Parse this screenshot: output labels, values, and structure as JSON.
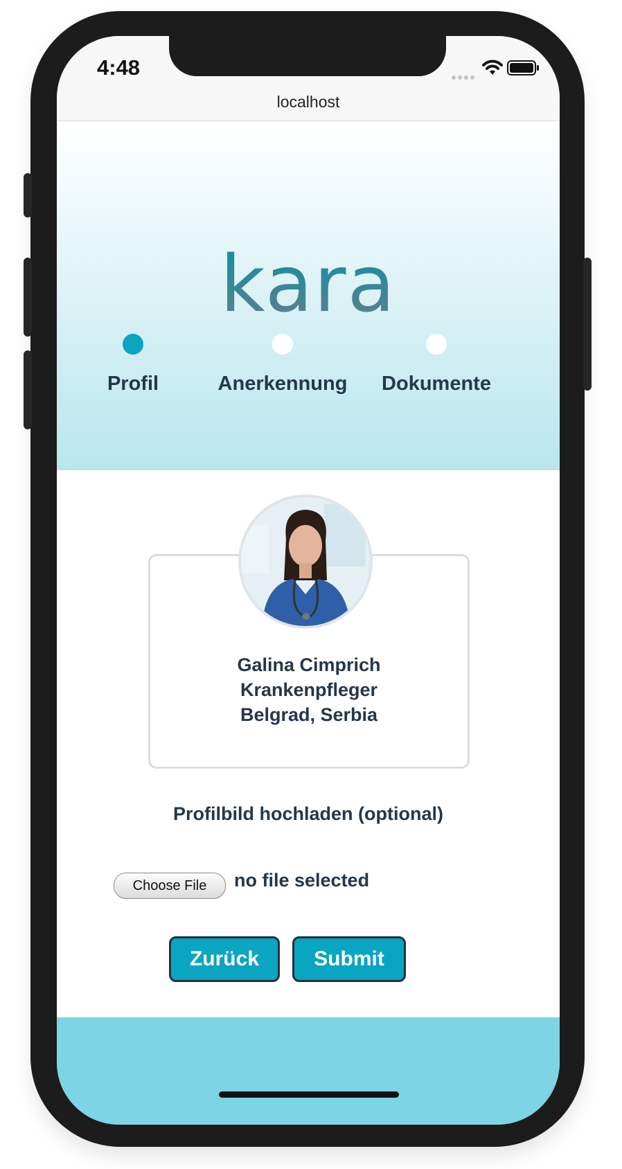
{
  "status_bar": {
    "time": "4:48",
    "url": "localhost",
    "icons": [
      "signal-icon",
      "wifi-icon",
      "battery-icon"
    ]
  },
  "header": {
    "logo_text": "kara",
    "steps": [
      {
        "label": "Profil",
        "active": true
      },
      {
        "label": "Anerkennung",
        "active": false
      },
      {
        "label": "Dokumente",
        "active": false
      }
    ]
  },
  "profile": {
    "name": "Galina Cimprich",
    "profession": "Krankenpfleger",
    "location": "Belgrad, Serbia"
  },
  "upload": {
    "heading": "Profilbild hochladen (optional)",
    "button_label": "Choose File",
    "status": "no file selected"
  },
  "actions": {
    "back_label": "Zurück",
    "submit_label": "Submit"
  },
  "colors": {
    "accent": "#0aa5c1",
    "text_dark": "#253749",
    "footer": "#7dd4e5"
  }
}
